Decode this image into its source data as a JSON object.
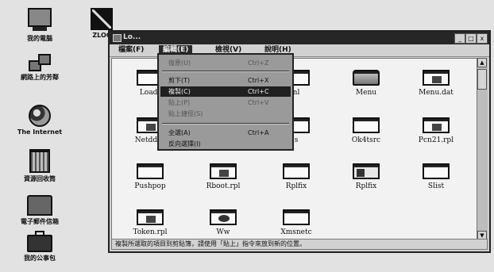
{
  "desktop_icons": [
    {
      "label": "我的電腦",
      "icon": "computer-icon"
    },
    {
      "label": "ZLOC",
      "icon": "zloc-icon"
    },
    {
      "label": "網路上的芳鄰",
      "icon": "network-icon"
    },
    {
      "label": "The Internet",
      "icon": "globe-icon"
    },
    {
      "label": "資源回收筒",
      "icon": "recycle-bin-icon"
    },
    {
      "label": "電子郵件信箱",
      "icon": "inbox-icon"
    },
    {
      "label": "我的公事包",
      "icon": "briefcase-icon"
    }
  ],
  "window": {
    "title": "Lo...",
    "buttons": {
      "minimize": "_",
      "maximize": "□",
      "close": "x"
    },
    "menubar": [
      "檔案(F)",
      "編輯(E)",
      "檢視(V)",
      "說明(H)"
    ],
    "edit_menu": [
      {
        "label": "復原(U)",
        "shortcut": "Ctrl+Z",
        "state": "disabled"
      },
      {
        "label": "剪下(T)",
        "shortcut": "Ctrl+X",
        "state": "normal"
      },
      {
        "label": "複製(C)",
        "shortcut": "Ctrl+C",
        "state": "highlighted"
      },
      {
        "label": "貼上(P)",
        "shortcut": "Ctrl+V",
        "state": "disabled"
      },
      {
        "label": "貼上捷徑(S)",
        "shortcut": "",
        "state": "disabled"
      },
      {
        "label": "全選(A)",
        "shortcut": "Ctrl+A",
        "state": "normal"
      },
      {
        "label": "反向選擇(I)",
        "shortcut": "",
        "state": "normal"
      }
    ],
    "files": [
      {
        "name": "Loadt",
        "icon": "window-file-icon"
      },
      {
        "name": "nl",
        "icon": "window-file-icon"
      },
      {
        "name": "Menu",
        "icon": "drive-icon"
      },
      {
        "name": "Menu.dat",
        "icon": "document-icon"
      },
      {
        "name": "Netddos",
        "icon": "document-icon"
      },
      {
        "name": "s",
        "icon": "window-file-icon"
      },
      {
        "name": "Ok4tsrc",
        "icon": "window-file-icon"
      },
      {
        "name": "Pcn21.rpl",
        "icon": "document-icon"
      },
      {
        "name": "Pushpop",
        "icon": "window-file-icon"
      },
      {
        "name": "Rboot.rpl",
        "icon": "document-icon"
      },
      {
        "name": "Rplfix",
        "icon": "window-file-icon"
      },
      {
        "name": "Rplfix",
        "icon": "dll-icon"
      },
      {
        "name": "Slist",
        "icon": "window-file-icon"
      },
      {
        "name": "Token.rpl",
        "icon": "document-icon"
      },
      {
        "name": "Ww",
        "icon": "ww-icon"
      },
      {
        "name": "Xmsnetc",
        "icon": "window-file-icon"
      }
    ],
    "status": "複製所選取的項目到剪貼簿，請使用「貼上」指令來放到新的位置。"
  }
}
